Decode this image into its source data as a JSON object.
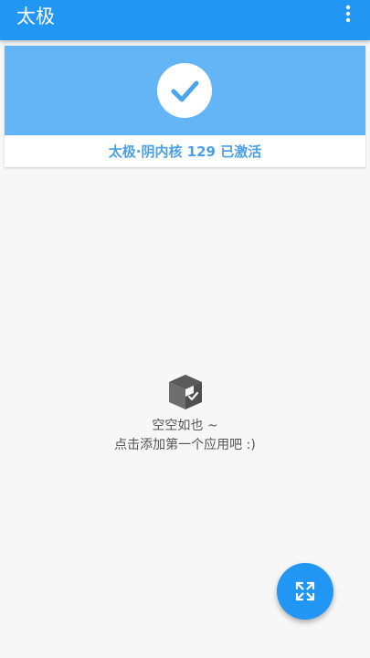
{
  "app_bar": {
    "title": "太极",
    "menu_icon": "more-vert-icon"
  },
  "status_card": {
    "icon": "check-icon",
    "status_text": "太极·阴内核 129 已激活"
  },
  "empty_state": {
    "icon": "box-icon",
    "line1": "空空如也 ~",
    "line2": "点击添加第一个应用吧 :)"
  },
  "fab": {
    "icon": "expand-icon"
  },
  "colors": {
    "primary": "#2196f3",
    "banner": "#64b5f6",
    "status_text": "#4a9fe6"
  }
}
